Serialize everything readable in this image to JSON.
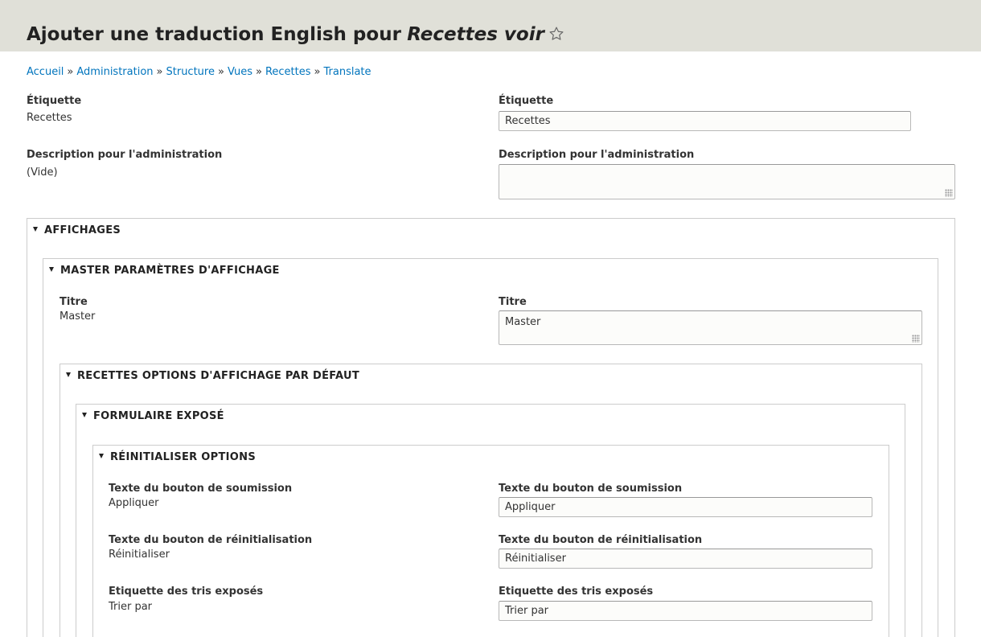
{
  "header": {
    "title_prefix": "Ajouter une traduction English pour",
    "title_view": "Recettes voir"
  },
  "breadcrumb": [
    "Accueil",
    "Administration",
    "Structure",
    "Vues",
    "Recettes",
    "Translate"
  ],
  "breadcrumb_separator": "»",
  "source": {
    "label_title": "Étiquette",
    "label_value": "Recettes",
    "desc_title": "Description pour l'administration",
    "desc_value": "(Vide)"
  },
  "translation": {
    "label_title": "Étiquette",
    "label_value": "Recettes",
    "desc_title": "Description pour l'administration",
    "desc_value": ""
  },
  "sections": {
    "affichages": "AFFICHAGES",
    "master": "MASTER PARAMÈTRES D'AFFICHAGE",
    "recettes_options": "RECETTES OPTIONS D'AFFICHAGE PAR DÉFAUT",
    "formulaire": "FORMULAIRE EXPOSÉ",
    "reinitialiser": "RÉINITIALISER OPTIONS"
  },
  "master_title": {
    "label": "Titre",
    "source_value": "Master",
    "translation_value": "Master"
  },
  "reset_options": [
    {
      "label": "Texte du bouton de soumission",
      "source_value": "Appliquer",
      "translation_value": "Appliquer"
    },
    {
      "label": "Texte du bouton de réinitialisation",
      "source_value": "Réinitialiser",
      "translation_value": "Réinitialiser"
    },
    {
      "label": "Etiquette des tris exposés",
      "source_value": "Trier par",
      "translation_value": "Trier par"
    }
  ]
}
